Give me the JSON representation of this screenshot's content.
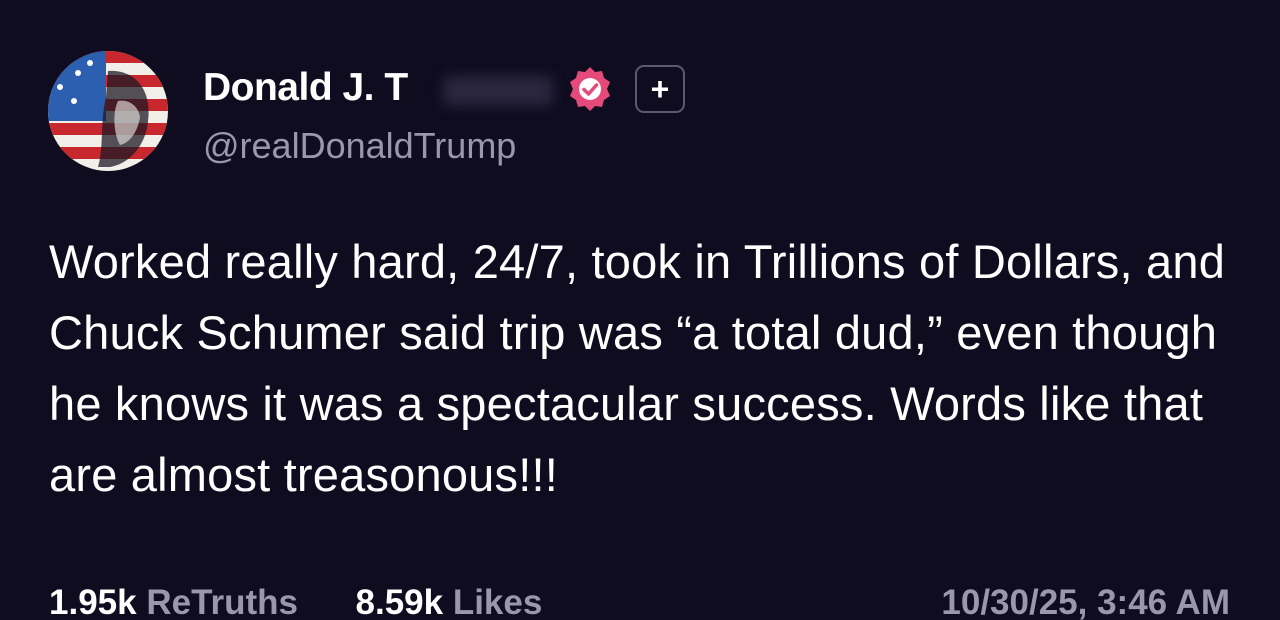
{
  "author": {
    "display_name": "Donald J. T",
    "handle": "@realDonaldTrump",
    "verified_icon": "verified-badge-icon",
    "add_icon": "add-plus-icon"
  },
  "post": {
    "text": "Worked really hard, 24/7, took in Trillions of Dollars, and Chuck Schumer said trip was “a total dud,” even though he knows it was a spectacular success. Words like that are almost treasonous!!!"
  },
  "stats": {
    "retruths_count": "1.95k",
    "retruths_label": "ReTruths",
    "likes_count": "8.59k",
    "likes_label": "Likes",
    "timestamp": "10/30/25, 3:46 AM"
  },
  "colors": {
    "background": "#0f0c1f",
    "text_primary": "#ffffff",
    "text_secondary": "#9a97ad",
    "verified_badge": "#e64a7a"
  }
}
